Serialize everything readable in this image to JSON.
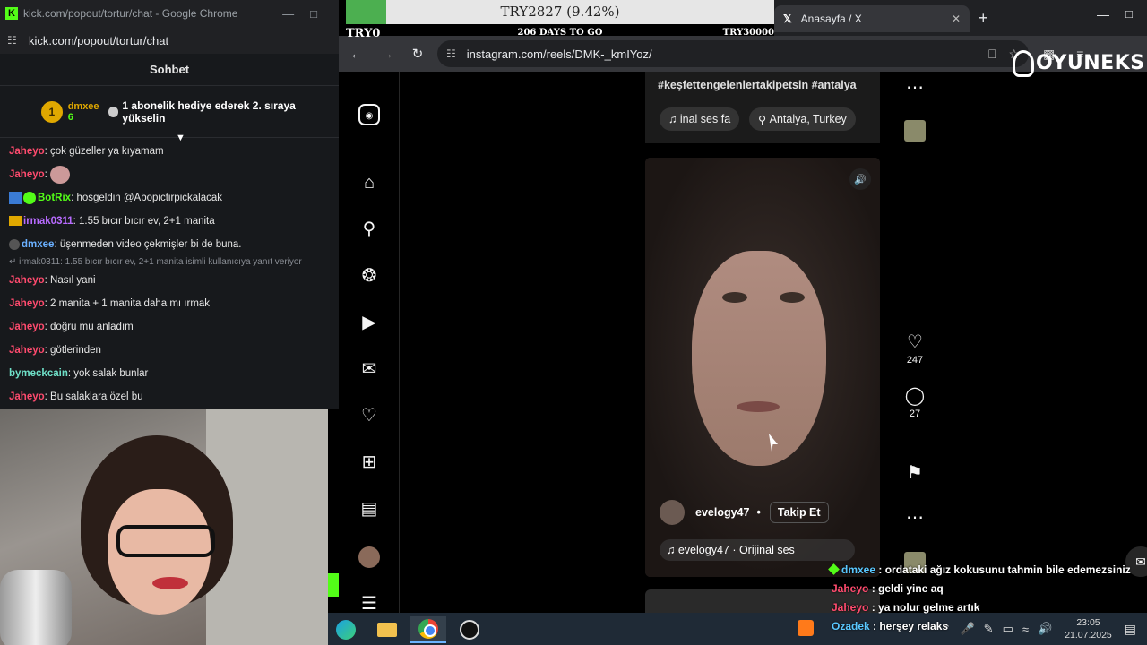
{
  "chat_window": {
    "title": "kick.com/popout/tortur/chat - Google Chrome",
    "url": "kick.com/popout/tortur/chat",
    "header": "Sohbet",
    "pinned": {
      "rank": "1",
      "user": "dmxee",
      "count": "6",
      "message": "1 abonelik hediye ederek 2. sıraya yükselin"
    },
    "messages": [
      {
        "user": "Jaheyo",
        "text": "çok güzeller ya kıyamam",
        "color": "red"
      },
      {
        "user": "Jaheyo",
        "text": "",
        "emote": true,
        "color": "red"
      },
      {
        "user": "BotRix",
        "text": "hosgeldin @Abopictirpickalacak",
        "color": "green",
        "badges": "bot"
      },
      {
        "user": "irmak0311",
        "text": "1.55 bıcır bıcır ev, 2+1 manita",
        "color": "purple",
        "badges": "crown"
      },
      {
        "user": "dmxee",
        "text": "üşenmeden video çekmişler bi de buna.",
        "color": "blue",
        "badges": "dot"
      },
      {
        "reply": "irmak0311: 1.55 bıcır bıcır ev, 2+1 manita isimli kullanıcıya yanıt veriyor"
      },
      {
        "user": "Jaheyo",
        "text": "Nasıl yani",
        "color": "red"
      },
      {
        "user": "Jaheyo",
        "text": "2 manita + 1 manita daha mı ırmak",
        "color": "red"
      },
      {
        "user": "Jaheyo",
        "text": "doğru mu anladım",
        "color": "red"
      },
      {
        "user": "Jaheyo",
        "text": "götlerinden",
        "color": "red"
      },
      {
        "user": "bymeckcain",
        "text": "yok salak bunlar",
        "color": "teal"
      },
      {
        "user": "Jaheyo",
        "text": "Bu salaklara özel bu",
        "color": "red"
      }
    ]
  },
  "goal": {
    "text": "TRY2827 (9.42%)",
    "progress": 0.0942,
    "start": "TRY0",
    "days": "206 DAYS TO GO",
    "end": "TRY30000",
    "fill_color": "#4caf50"
  },
  "browser": {
    "tab_title": "Anasayfa / X",
    "url": "instagram.com/reels/DMK-_kmIYoz/",
    "brand": "OYUNEKS"
  },
  "reels": {
    "prev": {
      "tags": "#keşfettengelenlertakipetsin #antalya",
      "audio": "inal ses  fa",
      "location": "Antalya, Turkey"
    },
    "current": {
      "username": "evelogy47",
      "separator": "•",
      "follow": "Takip Et",
      "audio": "evelogy47 · Orijinal ses",
      "likes": "247",
      "comments": "27"
    }
  },
  "overlay_chat": [
    {
      "user": "dmxee",
      "text": " : ordataki ağız kokusunu tahmin bile edemezsiniz",
      "color": "blue"
    },
    {
      "user": "Jaheyo",
      "text": " : geldi yine aq",
      "color": "red"
    },
    {
      "user": "Jaheyo",
      "text": " : ya nolur gelme artık",
      "color": "red"
    },
    {
      "user": "Ozadek",
      "text": " : herşey relaks",
      "color": "blue"
    }
  ],
  "taskbar": {
    "time": "23:05",
    "date": "21.07.2025"
  }
}
